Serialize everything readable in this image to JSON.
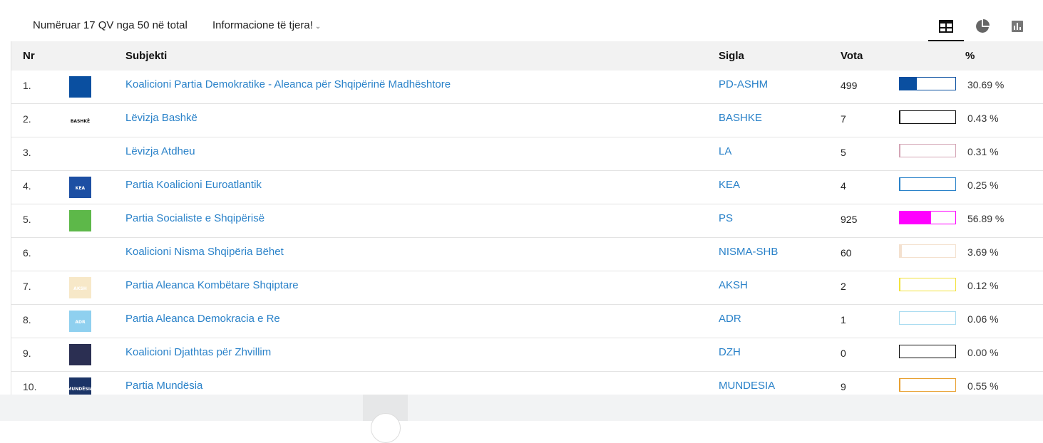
{
  "header": {
    "counted": "Numëruar 17 QV nga 50 në total",
    "more_info": "Informacione të tjera!",
    "views": [
      "table-icon",
      "pie-chart-icon",
      "bar-chart-icon"
    ]
  },
  "table": {
    "columns": {
      "nr": "Nr",
      "subject": "Subjekti",
      "sigla": "Sigla",
      "votes": "Vota",
      "percent": "%"
    },
    "rows": [
      {
        "nr": "1.",
        "name": "Koalicioni Partia Demokratike - Aleanca për Shqipërinë Madhështore",
        "sigla": "PD-ASHM",
        "votes": "499",
        "pct_label": "30.69 %",
        "pct": 30.69,
        "color": "#0a4fa0",
        "logo_color": "#0a4fa0",
        "logo_text": ""
      },
      {
        "nr": "2.",
        "name": "Lëvizja Bashkë",
        "sigla": "BASHKE",
        "votes": "7",
        "pct_label": "0.43 %",
        "pct": 0.43,
        "color": "#111111",
        "logo_color": "#ffffff",
        "logo_text": "BASHKË"
      },
      {
        "nr": "3.",
        "name": "Lëvizja Atdheu",
        "sigla": "LA",
        "votes": "5",
        "pct_label": "0.31 %",
        "pct": 0.31,
        "color": "#d4a5b5",
        "logo_color": "#ffffff",
        "logo_text": ""
      },
      {
        "nr": "4.",
        "name": "Partia Koalicioni Euroatlantik",
        "sigla": "KEA",
        "votes": "4",
        "pct_label": "0.25 %",
        "pct": 0.25,
        "color": "#2a82c9",
        "logo_color": "#1d4fa3",
        "logo_text": "KEA"
      },
      {
        "nr": "5.",
        "name": "Partia Socialiste e Shqipërisë",
        "sigla": "PS",
        "votes": "925",
        "pct_label": "56.89 %",
        "pct": 56.89,
        "color": "#ff00ff",
        "logo_color": "#5db849",
        "logo_text": ""
      },
      {
        "nr": "6.",
        "name": "Koalicioni Nisma Shqipëria Bëhet",
        "sigla": "NISMA-SHB",
        "votes": "60",
        "pct_label": "3.69 %",
        "pct": 3.69,
        "color": "#f4e1cf",
        "logo_color": "#ffffff",
        "logo_text": ""
      },
      {
        "nr": "7.",
        "name": "Partia Aleanca Kombëtare Shqiptare",
        "sigla": "AKSH",
        "votes": "2",
        "pct_label": "0.12 %",
        "pct": 0.12,
        "color": "#f2e23c",
        "logo_color": "#f7e8c8",
        "logo_text": "AKSH"
      },
      {
        "nr": "8.",
        "name": "Partia Aleanca Demokracia e Re",
        "sigla": "ADR",
        "votes": "1",
        "pct_label": "0.06 %",
        "pct": 0.06,
        "color": "#a9dcf0",
        "logo_color": "#8fd0ef",
        "logo_text": "ADR"
      },
      {
        "nr": "9.",
        "name": "Koalicioni Djathtas për Zhvillim",
        "sigla": "DZH",
        "votes": "0",
        "pct_label": "0.00 %",
        "pct": 0.0,
        "color": "#111111",
        "logo_color": "#2b2f52",
        "logo_text": ""
      },
      {
        "nr": "10.",
        "name": "Partia Mundësia",
        "sigla": "MUNDESIA",
        "votes": "9",
        "pct_label": "0.55 %",
        "pct": 0.55,
        "color": "#e8a030",
        "logo_color": "#1b3466",
        "logo_text": "MUNDËSIA"
      }
    ]
  }
}
